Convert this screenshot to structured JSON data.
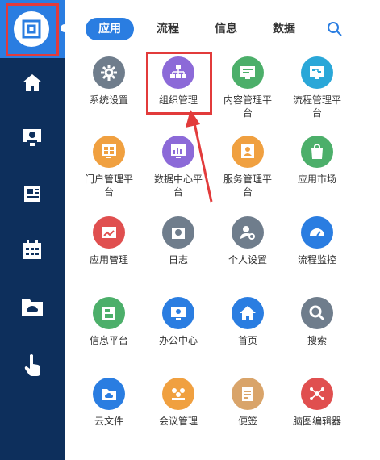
{
  "tabs": [
    {
      "label": "应用",
      "active": true
    },
    {
      "label": "流程",
      "active": false
    },
    {
      "label": "信息",
      "active": false
    },
    {
      "label": "数据",
      "active": false
    }
  ],
  "apps": [
    {
      "label": "系统设置",
      "icon": "gear-icon",
      "color": "#6f7d8c"
    },
    {
      "label": "组织管理",
      "icon": "org-icon",
      "color": "#8c6ad8"
    },
    {
      "label": "内容管理平台",
      "icon": "monitor-doc-icon",
      "color": "#4caf6a"
    },
    {
      "label": "流程管理平台",
      "icon": "flow-icon",
      "color": "#2aa7d8"
    },
    {
      "label": "门户管理平台",
      "icon": "portal-icon",
      "color": "#f0a040"
    },
    {
      "label": "数据中心平台",
      "icon": "chart-icon",
      "color": "#8c6ad8"
    },
    {
      "label": "服务管理平台",
      "icon": "service-icon",
      "color": "#f0a040"
    },
    {
      "label": "应用市场",
      "icon": "bag-icon",
      "color": "#4caf6a"
    },
    {
      "label": "应用管理",
      "icon": "app-manage-icon",
      "color": "#e04f4f"
    },
    {
      "label": "日志",
      "icon": "log-icon",
      "color": "#6f7d8c"
    },
    {
      "label": "个人设置",
      "icon": "user-gear-icon",
      "color": "#6f7d8c"
    },
    {
      "label": "流程监控",
      "icon": "gauge-icon",
      "color": "#2a7de1"
    },
    {
      "label": "信息平台",
      "icon": "news-icon",
      "color": "#4caf6a"
    },
    {
      "label": "办公中心",
      "icon": "office-icon",
      "color": "#2a7de1"
    },
    {
      "label": "首页",
      "icon": "home-icon",
      "color": "#2a7de1"
    },
    {
      "label": "搜索",
      "icon": "search-icon",
      "color": "#6f7d8c"
    },
    {
      "label": "云文件",
      "icon": "cloud-folder-icon",
      "color": "#2a7de1"
    },
    {
      "label": "会议管理",
      "icon": "meeting-icon",
      "color": "#f0a040"
    },
    {
      "label": "便签",
      "icon": "note-icon",
      "color": "#d9a46a"
    },
    {
      "label": "脑图编辑器",
      "icon": "mindmap-icon",
      "color": "#e04f4f"
    }
  ]
}
